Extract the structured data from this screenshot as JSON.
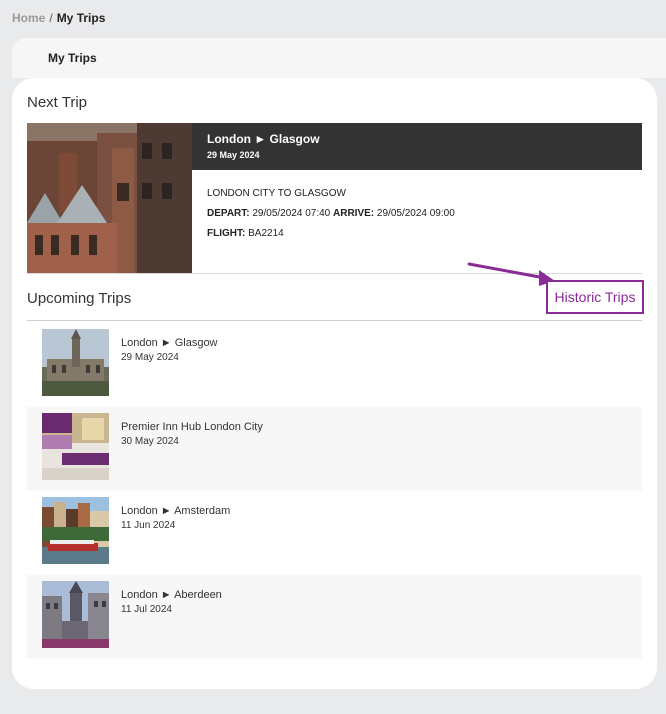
{
  "breadcrumb": {
    "home": "Home",
    "separator": "/",
    "current": "My Trips"
  },
  "tabs": {
    "my_trips": "My Trips"
  },
  "next_trip": {
    "section_title": "Next Trip",
    "route": "London ► Glasgow",
    "date": "29 May 2024",
    "description": "LONDON CITY TO GLASGOW",
    "depart_label": "DEPART:",
    "depart_value": "29/05/2024 07:40",
    "arrive_label": "ARRIVE:",
    "arrive_value": "29/05/2024 09:00",
    "flight_label": "FLIGHT:",
    "flight_value": "BA2214"
  },
  "upcoming": {
    "section_title": "Upcoming Trips",
    "historic_button": "Historic Trips",
    "trips": [
      {
        "name": "London ► Glasgow",
        "date": "29 May 2024",
        "thumb": "glasgow-university"
      },
      {
        "name": "Premier Inn Hub London City",
        "date": "30 May 2024",
        "thumb": "hotel-room"
      },
      {
        "name": "London ► Amsterdam",
        "date": "11 Jun 2024",
        "thumb": "amsterdam-canal"
      },
      {
        "name": "London ► Aberdeen",
        "date": "11 Jul 2024",
        "thumb": "aberdeen-street"
      }
    ]
  },
  "colors": {
    "accent": "#8b2c96",
    "header_dark": "#333333",
    "page_bg": "#e9eaec"
  }
}
